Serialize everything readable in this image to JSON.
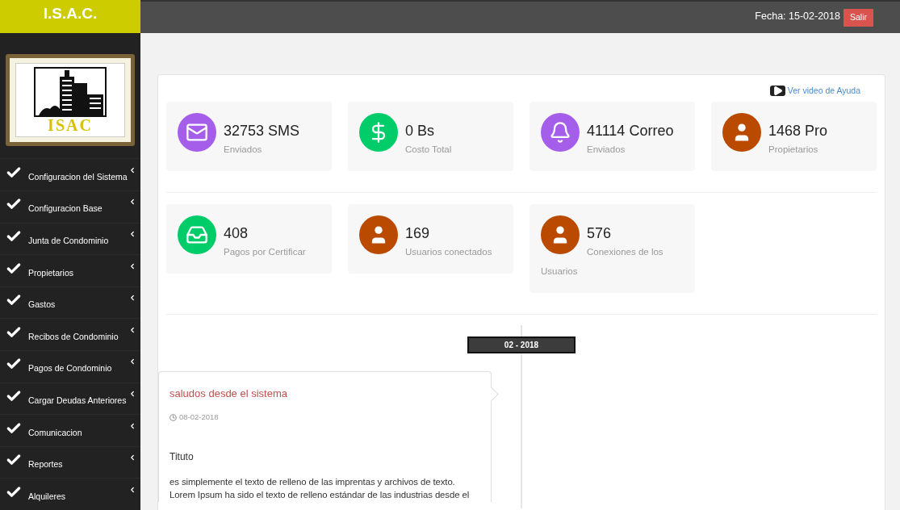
{
  "brand": "I.S.A.C.",
  "header": {
    "date": "Fecha: 15-02-2018",
    "logout": "Salir"
  },
  "logo": {
    "text": "ISAC"
  },
  "sidebar": {
    "items": [
      {
        "label": "Configuracion del Sistema"
      },
      {
        "label": "Configuracion Base"
      },
      {
        "label": "Junta de Condominio"
      },
      {
        "label": "Propietarios"
      },
      {
        "label": "Gastos"
      },
      {
        "label": "Recibos de Condominio"
      },
      {
        "label": "Pagos de Condominio"
      },
      {
        "label": "Cargar Deudas Anteriores"
      },
      {
        "label": "Comunicacion"
      },
      {
        "label": "Reportes"
      },
      {
        "label": "Alquileres"
      }
    ]
  },
  "help_link": "Ver video de Ayuda",
  "stat_rows": [
    [
      {
        "kind": "mail",
        "color": "#a55eea",
        "value": "32753 SMS",
        "label": "Enviados"
      },
      {
        "kind": "dollar",
        "color": "#00cc6a",
        "value": "0 Bs",
        "label": "Costo Total"
      },
      {
        "kind": "bell",
        "color": "#a55eea",
        "value": "41114 Correo",
        "label": "Enviados"
      },
      {
        "kind": "user",
        "color": "#b94a00",
        "value": "1468 Pro",
        "label": "Propietarios"
      }
    ],
    [
      {
        "kind": "inbox",
        "color": "#00cc6a",
        "value": "408",
        "label": "Pagos por Certificar"
      },
      {
        "kind": "user",
        "color": "#b94a00",
        "value": "169",
        "label": "Usuarios conectados"
      },
      {
        "kind": "user",
        "color": "#b94a00",
        "value": "576",
        "label": "Conexiones de los Usuarios"
      }
    ]
  ],
  "timeline": {
    "period": "02 - 2018",
    "post": {
      "title": "saludos desde el sistema",
      "date": "08-02-2018",
      "heading": "Tituto",
      "body": "es simplemente el texto de relleno de las imprentas y archivos de texto. Lorem Ipsum ha sido el texto de relleno estándar de las industrias desde el"
    }
  }
}
